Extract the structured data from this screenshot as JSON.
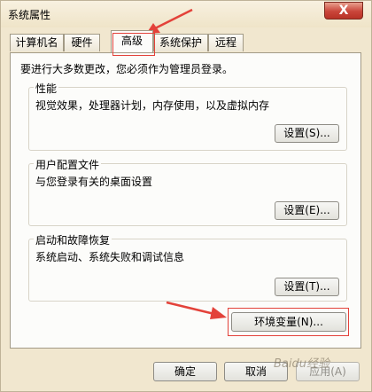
{
  "window": {
    "title": "系统属性",
    "close_glyph": "X"
  },
  "tabs": [
    {
      "label": "计算机名",
      "active": false
    },
    {
      "label": "硬件",
      "active": false
    },
    {
      "label": "高级",
      "active": true
    },
    {
      "label": "系统保护",
      "active": false
    },
    {
      "label": "远程",
      "active": false
    }
  ],
  "notice": "要进行大多数更改，您必须作为管理员登录。",
  "performance": {
    "label": "性能",
    "description": "视觉效果，处理器计划，内存使用，以及虚拟内存",
    "button": "设置(S)..."
  },
  "user_profiles": {
    "label": "用户配置文件",
    "description": "与您登录有关的桌面设置",
    "button": "设置(E)..."
  },
  "startup_recovery": {
    "label": "启动和故障恢复",
    "description": "系统启动、系统失败和调试信息",
    "button": "设置(T)..."
  },
  "env_button": "环境变量(N)...",
  "footer": {
    "ok": "确定",
    "cancel": "取消",
    "apply": "应用(A)"
  },
  "watermark": "Baidu经验",
  "colors": {
    "annotation_red": "#e3423a",
    "window_bg": "#f1e7cf",
    "panel_bg": "#fcfcfa"
  }
}
